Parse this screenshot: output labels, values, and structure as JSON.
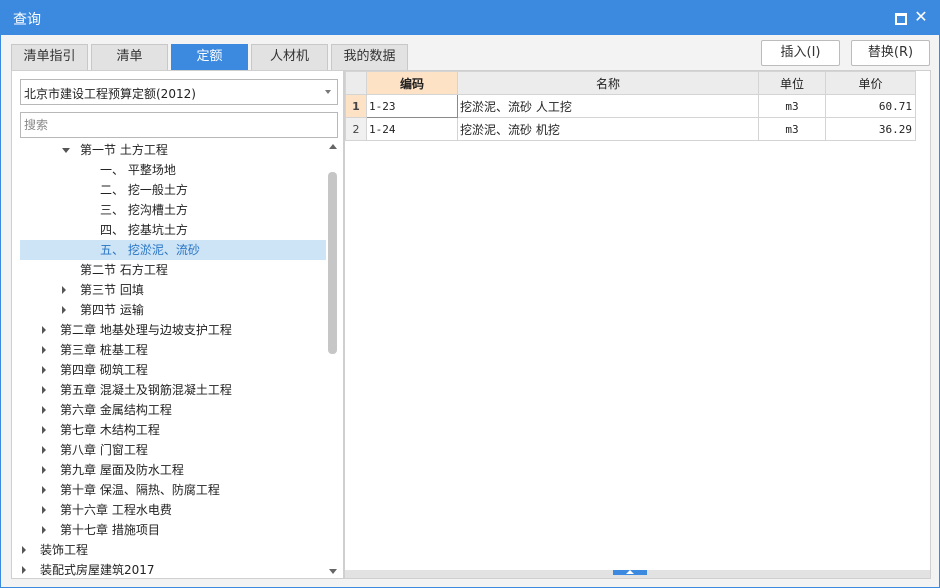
{
  "window": {
    "title": "查询"
  },
  "tabs": [
    {
      "label": "清单指引"
    },
    {
      "label": "清单"
    },
    {
      "label": "定额"
    },
    {
      "label": "人材机"
    },
    {
      "label": "我的数据"
    }
  ],
  "active_tab": "定额",
  "actions": {
    "insert_label": "插入(I)",
    "replace_label": "替换(R)"
  },
  "left": {
    "library_select": "北京市建设工程预算定额(2012)",
    "search_placeholder": "搜索",
    "tree": [
      {
        "label": "第一节  土方工程",
        "expander": "expanded"
      },
      {
        "label": "一、  平整场地",
        "expander": "none"
      },
      {
        "label": "二、  挖一般土方",
        "expander": "none"
      },
      {
        "label": "三、  挖沟槽土方",
        "expander": "none"
      },
      {
        "label": "四、  挖基坑土方",
        "expander": "none"
      },
      {
        "label": "五、  挖淤泥、流砂",
        "expander": "none",
        "selected": true
      },
      {
        "label": "第二节  石方工程",
        "expander": "none"
      },
      {
        "label": "第三节  回填",
        "expander": "collapsed"
      },
      {
        "label": "第四节  运输",
        "expander": "collapsed"
      },
      {
        "label": "第二章  地基处理与边坡支护工程",
        "expander": "collapsed"
      },
      {
        "label": "第三章  桩基工程",
        "expander": "collapsed"
      },
      {
        "label": "第四章  砌筑工程",
        "expander": "collapsed"
      },
      {
        "label": "第五章  混凝土及钢筋混凝土工程",
        "expander": "collapsed"
      },
      {
        "label": "第六章  金属结构工程",
        "expander": "collapsed"
      },
      {
        "label": "第七章  木结构工程",
        "expander": "collapsed"
      },
      {
        "label": "第八章  门窗工程",
        "expander": "collapsed"
      },
      {
        "label": "第九章  屋面及防水工程",
        "expander": "collapsed"
      },
      {
        "label": "第十章  保温、隔热、防腐工程",
        "expander": "collapsed"
      },
      {
        "label": "第十六章  工程水电费",
        "expander": "collapsed"
      },
      {
        "label": "第十七章  措施项目",
        "expander": "collapsed"
      },
      {
        "label": "装饰工程",
        "expander": "collapsed"
      },
      {
        "label": "装配式房屋建筑2017",
        "expander": "collapsed"
      }
    ]
  },
  "grid": {
    "headers": {
      "code": "编码",
      "name": "名称",
      "unit": "单位",
      "price": "单价"
    },
    "rows": [
      {
        "no": "1",
        "code": "1-23",
        "name": "挖淤泥、流砂  人工挖",
        "unit": "m3",
        "price": "60.71"
      },
      {
        "no": "2",
        "code": "1-24",
        "name": "挖淤泥、流砂  机挖",
        "unit": "m3",
        "price": "36.29"
      }
    ]
  },
  "colors": {
    "accent": "#3b8ae0",
    "selection": "#cde4f7",
    "header_highlight": "#fde2c5"
  }
}
